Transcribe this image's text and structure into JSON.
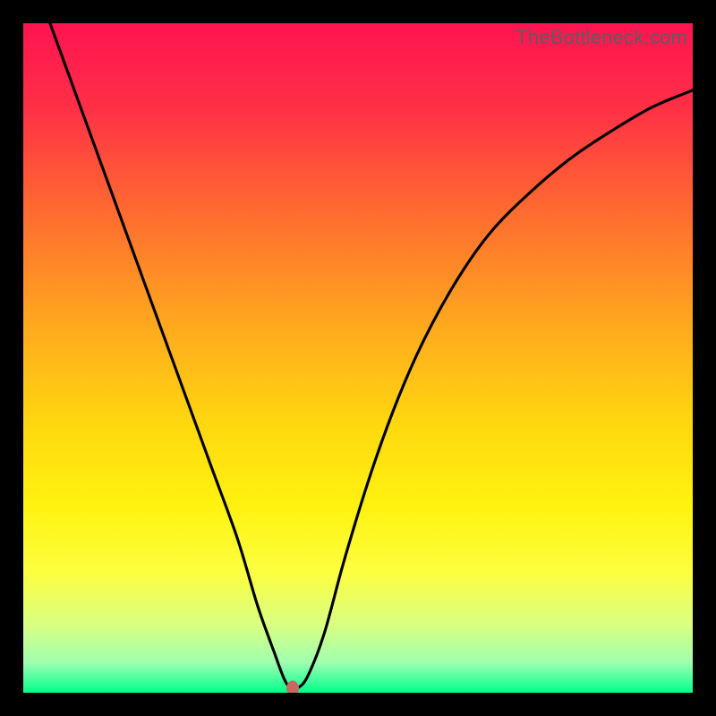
{
  "watermark": "TheBottleneck.com",
  "chart_data": {
    "type": "line",
    "title": "",
    "xlabel": "",
    "ylabel": "",
    "xlim": [
      0,
      100
    ],
    "ylim": [
      0,
      100
    ],
    "gradient_stops": [
      {
        "pos": 0.0,
        "color": "#ff1452"
      },
      {
        "pos": 0.12,
        "color": "#ff2e47"
      },
      {
        "pos": 0.28,
        "color": "#ff6a30"
      },
      {
        "pos": 0.45,
        "color": "#ffa81e"
      },
      {
        "pos": 0.6,
        "color": "#ffd80f"
      },
      {
        "pos": 0.72,
        "color": "#fff210"
      },
      {
        "pos": 0.82,
        "color": "#fbff40"
      },
      {
        "pos": 0.9,
        "color": "#d9ff84"
      },
      {
        "pos": 0.955,
        "color": "#9fffb0"
      },
      {
        "pos": 0.985,
        "color": "#35ff9a"
      },
      {
        "pos": 1.0,
        "color": "#05ff87"
      }
    ],
    "series": [
      {
        "name": "bottleneck-curve",
        "x": [
          4,
          8,
          12,
          16,
          20,
          24,
          28,
          32,
          35,
          37.5,
          39,
          40,
          41,
          42.5,
          45,
          48,
          52,
          56,
          60,
          65,
          70,
          76,
          82,
          88,
          94,
          100
        ],
        "y": [
          100,
          89,
          78,
          67,
          56,
          45,
          34,
          23,
          13,
          6,
          2,
          0.7,
          0.7,
          2.5,
          9,
          20,
          33,
          44,
          53,
          62,
          69,
          75,
          80,
          84,
          87.5,
          90
        ]
      }
    ],
    "marker": {
      "x": 40.3,
      "y": 0.7
    }
  }
}
